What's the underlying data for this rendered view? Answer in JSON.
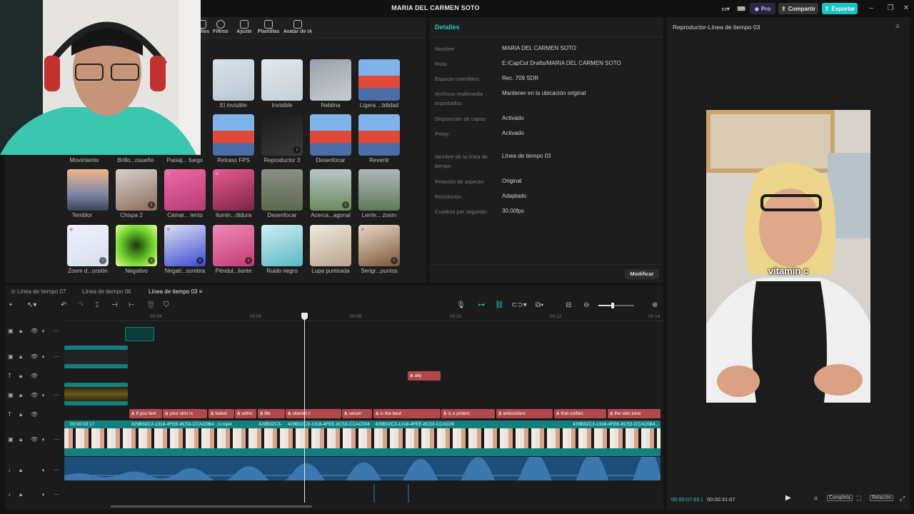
{
  "window": {
    "title": "MARIA DEL CARMEN SOTO",
    "pro_label": "Pro",
    "share_label": "Compartir",
    "export_label": "Exportar"
  },
  "colors": {
    "accent": "#20c9c9",
    "export": "#1ec2c2",
    "text_clip": "#b2484d",
    "video_clip": "#137f7f",
    "audio": "#1d4e7a"
  },
  "toolbar": {
    "tabs": [
      {
        "label": "...dios",
        "icon": "media-icon"
      },
      {
        "label": "Filtros",
        "icon": "filter-icon"
      },
      {
        "label": "Ajuste",
        "icon": "adjust-icon"
      },
      {
        "label": "Plantillas",
        "icon": "template-icon"
      },
      {
        "label": "Avatar de IA",
        "icon": "avatar-icon"
      }
    ]
  },
  "effects": {
    "row1": [
      "El invisible",
      "Invisible",
      "Neblina",
      "Ligera ...bilidad"
    ],
    "row2": [
      "Movimiento",
      "Brillo...nsueño",
      "Paisaj... fuego",
      "Retraso FPS",
      "Reproductor 3",
      "Desenfocar",
      "Revertir"
    ],
    "row3": [
      "Temblor",
      "Chispa 2",
      "Cámar... iento",
      "Ilumin...didura",
      "Desenfocar",
      "Acerca...agonal",
      "Lente... zoom"
    ],
    "row4": [
      "Zoom d...orsión",
      "Negativo",
      "Negati...sombra",
      "Péndul...liante",
      "Ruido negro",
      "Lupa punteada",
      "Serigr...puntos"
    ]
  },
  "details": {
    "header": "Detalles",
    "rows": [
      {
        "key": "Nombre:",
        "value": "MARIA DEL CARMEN SOTO"
      },
      {
        "key": "Ruta:",
        "value": "E:/CapCut Drafts/MARIA DEL CARMEN SOTO"
      },
      {
        "key": "Espacio cromático:",
        "value": "Rec. 709 SDR"
      },
      {
        "key": "Archivos multimedia importados:",
        "value": "Mantener en la ubicación original"
      },
      {
        "key": "Disposición de capas",
        "value": "Activado"
      },
      {
        "key": "Proxy:",
        "value": "Activado"
      },
      {
        "key": "Nombre de la línea de tiempo",
        "value": "Línea de tiempo 03"
      },
      {
        "key": "Relación de aspecto:",
        "value": "Original"
      },
      {
        "key": "Resolución:",
        "value": "Adaptado"
      },
      {
        "key": "Cuadros por segundo:",
        "value": "30.00fps"
      }
    ],
    "modify_label": "Modificar"
  },
  "player": {
    "title": "Reproductor-Línea de tiempo 03",
    "caption": "vitamin c",
    "current_time": "00:00:07:03",
    "total_time": "00:00:31:07",
    "full_label": "Completa",
    "ratio_label": "Relación"
  },
  "timeline": {
    "tabs": [
      "Línea de tiempo 07",
      "Línea de tiempo 06",
      "Línea de tiempo 03"
    ],
    "ruler": [
      "00:04",
      "00:06",
      "00:08",
      "00:10",
      "00:12",
      "00:14"
    ],
    "floating_text": "ally",
    "text_clips": [
      "If you feel",
      "your skin is",
      "faded",
      "witho",
      "life",
      "vitamin c",
      "serum",
      "is the best",
      "is a potent",
      "antioxidant",
      "that unifies",
      "the skin tone"
    ],
    "video_clip_time": "00:00:03:17",
    "video_clip_name": "429B32C3-1318-4FEE-8C53-CCAC0B4...U.mp4",
    "video_clip_short": "429B32C3-",
    "video_clip_mid": "429B32C3-1318-4FEE-8C53-CCAC004",
    "video_clip_name2": "429B32C3-1318-4FEE-8C53-CCAC00",
    "video_clip_tail": "429B32C3-1318-4FEE-8C53-CCAC0B4..."
  }
}
